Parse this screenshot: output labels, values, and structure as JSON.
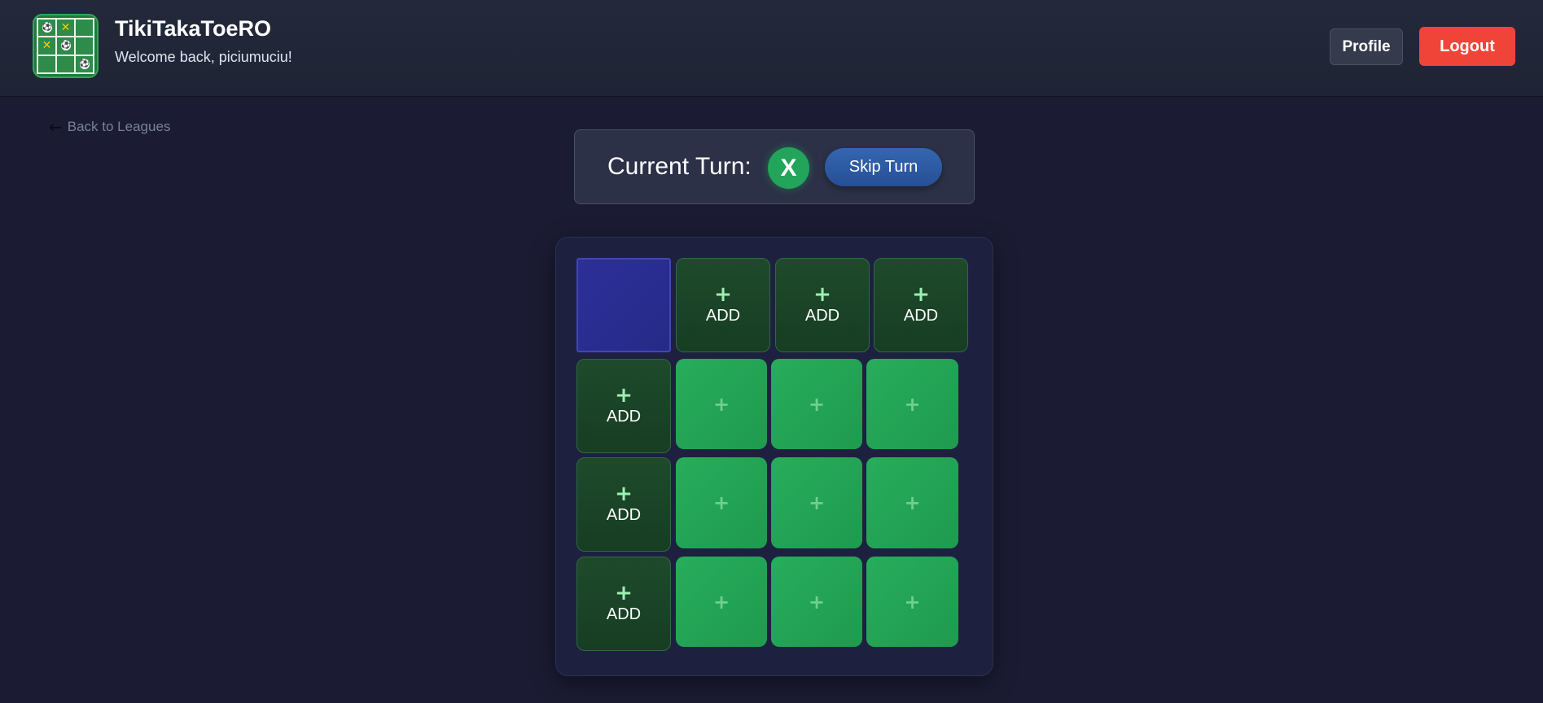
{
  "header": {
    "app_title": "TikiTakaToeRO",
    "welcome": "Welcome back, piciumuciu!",
    "profile_label": "Profile",
    "logout_label": "Logout"
  },
  "logo": {
    "cells": [
      "ball",
      "x",
      "",
      "x",
      "ball",
      "",
      "",
      "",
      "ball"
    ]
  },
  "nav": {
    "back_label": "Back to Leagues",
    "back_icon": "arrow-left-icon"
  },
  "turn": {
    "label": "Current Turn:",
    "player": "X",
    "skip_label": "Skip Turn"
  },
  "board": {
    "column_headers": [
      {
        "plus": "+",
        "label": "ADD"
      },
      {
        "plus": "+",
        "label": "ADD"
      },
      {
        "plus": "+",
        "label": "ADD"
      }
    ],
    "row_headers": [
      {
        "plus": "+",
        "label": "ADD"
      },
      {
        "plus": "+",
        "label": "ADD"
      },
      {
        "plus": "+",
        "label": "ADD"
      }
    ],
    "cell_symbol": "+"
  },
  "colors": {
    "logout": "#f04438",
    "turn_badge": "#22a45a",
    "skip_button": "#2b5aa3",
    "cell_green": "#24a556",
    "header_cell": "#1b4427",
    "corner": "#2a2c92"
  }
}
